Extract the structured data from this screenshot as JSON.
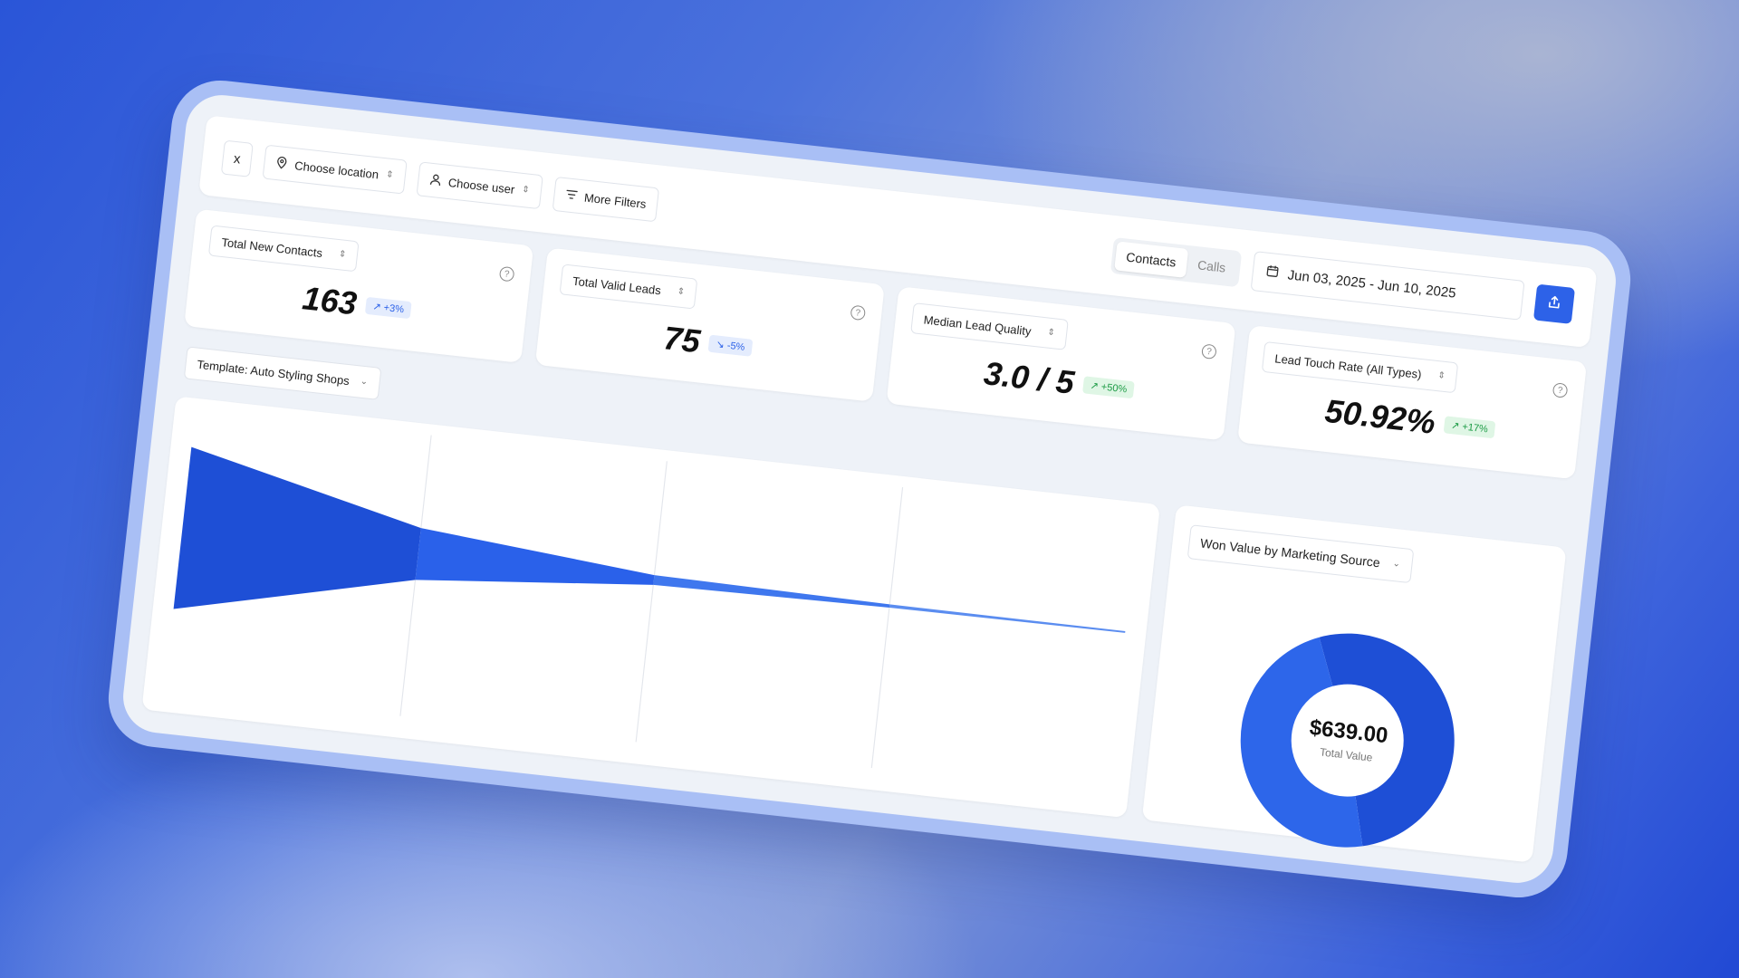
{
  "filters": {
    "close_icon": "x",
    "location": "Choose location",
    "user": "Choose user",
    "more": "More Filters"
  },
  "view_toggle": {
    "contacts": "Contacts",
    "calls": "Calls",
    "selected": "Contacts"
  },
  "date_range": "Jun 03, 2025 - Jun 10, 2025",
  "kpis": [
    {
      "label": "Total New Contacts",
      "value": "163",
      "delta": "+3%",
      "direction": "up",
      "color": "#2d62e8"
    },
    {
      "label": "Total Valid Leads",
      "value": "75",
      "delta": "-5%",
      "direction": "down",
      "color": "#2d62e8"
    },
    {
      "label": "Median Lead Quality",
      "value": "3.0 / 5",
      "delta": "+50%",
      "direction": "up",
      "color": "#1c9b45"
    },
    {
      "label": "Lead Touch Rate (All Types)",
      "value": "50.92%",
      "delta": "+17%",
      "direction": "up",
      "color": "#1c9b45"
    }
  ],
  "funnel": {
    "template": "Template: Auto Styling Shops",
    "stages": [
      1.0,
      0.32,
      0.06,
      0.02,
      0.005
    ]
  },
  "donut": {
    "title": "Won Value by Marketing Source",
    "total": "$639.00",
    "total_label": "Total Value",
    "segments": [
      {
        "value": 0.52,
        "color": "#1e4fd6"
      },
      {
        "value": 0.48,
        "color": "#2d66ea"
      }
    ]
  }
}
